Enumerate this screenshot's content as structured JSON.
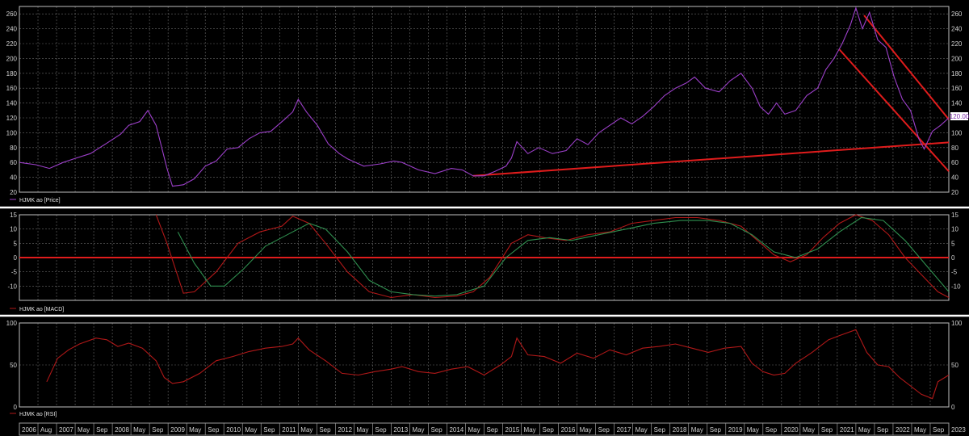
{
  "colors": {
    "background": "#000000",
    "price": "#9b3fc8",
    "macd": "#b01818",
    "signal": "#2f8f4f",
    "rsi": "#b01818",
    "trend": "#e01c1c",
    "separator": "#ffffff",
    "price_badge_bg": "#ffffff",
    "price_badge_fg": "#7a2aa8"
  },
  "current_price_label": "120.00",
  "legend": {
    "price": "HJMK ao [Price]",
    "macd": "HJMK ao [MACD]",
    "rsi": "HJMK ao [RSI]"
  },
  "x_axis_labels": [
    "2006",
    "Aug",
    "2007",
    "May",
    "Sep",
    "2008",
    "May",
    "Sep",
    "2009",
    "May",
    "Sep",
    "2010",
    "May",
    "Sep",
    "2011",
    "May",
    "Sep",
    "2012",
    "May",
    "Sep",
    "2013",
    "May",
    "Sep",
    "2014",
    "May",
    "Sep",
    "2015",
    "May",
    "Sep",
    "2016",
    "May",
    "Sep",
    "2017",
    "May",
    "Sep",
    "2018",
    "May",
    "Sep",
    "2019",
    "May",
    "Sep",
    "2020",
    "May",
    "Sep",
    "2021",
    "May",
    "Sep",
    "2022",
    "May",
    "Sep",
    "2023"
  ],
  "chart_data": [
    {
      "type": "line",
      "panel": "price",
      "x_range": [
        2006.0,
        2023.0
      ],
      "ylim": [
        20,
        270
      ],
      "y_ticks": [
        20,
        40,
        60,
        80,
        100,
        120,
        140,
        160,
        180,
        200,
        220,
        240,
        260
      ],
      "grid": true,
      "legend": "bottom-left",
      "series": [
        {
          "name": "HJMK ao [Price]",
          "points": [
            [
              2006.0,
              60
            ],
            [
              2006.3,
              57
            ],
            [
              2006.55,
              52
            ],
            [
              2006.8,
              60
            ],
            [
              2007.0,
              65
            ],
            [
              2007.3,
              72
            ],
            [
              2007.6,
              86
            ],
            [
              2007.85,
              98
            ],
            [
              2008.0,
              110
            ],
            [
              2008.2,
              115
            ],
            [
              2008.35,
              130
            ],
            [
              2008.5,
              110
            ],
            [
              2008.7,
              52
            ],
            [
              2008.8,
              28
            ],
            [
              2009.0,
              30
            ],
            [
              2009.2,
              38
            ],
            [
              2009.4,
              55
            ],
            [
              2009.6,
              62
            ],
            [
              2009.8,
              78
            ],
            [
              2010.0,
              80
            ],
            [
              2010.2,
              92
            ],
            [
              2010.4,
              100
            ],
            [
              2010.6,
              102
            ],
            [
              2010.85,
              118
            ],
            [
              2011.0,
              128
            ],
            [
              2011.1,
              145
            ],
            [
              2011.25,
              128
            ],
            [
              2011.45,
              110
            ],
            [
              2011.65,
              85
            ],
            [
              2011.85,
              72
            ],
            [
              2012.0,
              65
            ],
            [
              2012.3,
              55
            ],
            [
              2012.6,
              58
            ],
            [
              2012.85,
              62
            ],
            [
              2013.0,
              60
            ],
            [
              2013.3,
              50
            ],
            [
              2013.6,
              45
            ],
            [
              2013.9,
              52
            ],
            [
              2014.1,
              50
            ],
            [
              2014.3,
              42
            ],
            [
              2014.5,
              42
            ],
            [
              2014.7,
              48
            ],
            [
              2014.9,
              55
            ],
            [
              2015.0,
              66
            ],
            [
              2015.1,
              88
            ],
            [
              2015.3,
              72
            ],
            [
              2015.5,
              80
            ],
            [
              2015.75,
              72
            ],
            [
              2016.0,
              76
            ],
            [
              2016.2,
              92
            ],
            [
              2016.4,
              84
            ],
            [
              2016.6,
              100
            ],
            [
              2016.8,
              110
            ],
            [
              2017.0,
              120
            ],
            [
              2017.2,
              112
            ],
            [
              2017.4,
              122
            ],
            [
              2017.6,
              135
            ],
            [
              2017.8,
              150
            ],
            [
              2018.0,
              160
            ],
            [
              2018.2,
              167
            ],
            [
              2018.35,
              175
            ],
            [
              2018.55,
              160
            ],
            [
              2018.8,
              155
            ],
            [
              2019.0,
              170
            ],
            [
              2019.2,
              180
            ],
            [
              2019.4,
              160
            ],
            [
              2019.55,
              135
            ],
            [
              2019.7,
              125
            ],
            [
              2019.85,
              140
            ],
            [
              2020.0,
              125
            ],
            [
              2020.2,
              130
            ],
            [
              2020.4,
              150
            ],
            [
              2020.6,
              160
            ],
            [
              2020.75,
              185
            ],
            [
              2020.9,
              200
            ],
            [
              2021.05,
              220
            ],
            [
              2021.2,
              245
            ],
            [
              2021.3,
              268
            ],
            [
              2021.42,
              240
            ],
            [
              2021.55,
              262
            ],
            [
              2021.7,
              225
            ],
            [
              2021.85,
              215
            ],
            [
              2022.0,
              175
            ],
            [
              2022.15,
              145
            ],
            [
              2022.3,
              130
            ],
            [
              2022.45,
              92
            ],
            [
              2022.55,
              78
            ],
            [
              2022.7,
              102
            ],
            [
              2022.85,
              110
            ],
            [
              2023.0,
              120
            ]
          ]
        }
      ],
      "trendlines": [
        {
          "from": [
            2014.3,
            42
          ],
          "to": [
            2023.0,
            87
          ]
        },
        {
          "from": [
            2021.0,
            212
          ],
          "to": [
            2023.0,
            48
          ]
        },
        {
          "from": [
            2021.45,
            258
          ],
          "to": [
            2023.0,
            118
          ]
        }
      ]
    },
    {
      "type": "line",
      "panel": "macd",
      "x_range": [
        2006.0,
        2023.0
      ],
      "ylim": [
        -15,
        15
      ],
      "y_ticks": [
        -10,
        -5,
        0,
        5,
        10,
        15
      ],
      "zero_line": 0,
      "grid": true,
      "legend": "bottom-left",
      "series": [
        {
          "name": "HJMK ao [MACD]",
          "role": "macd",
          "points": [
            [
              2008.5,
              15
            ],
            [
              2008.7,
              5
            ],
            [
              2009.0,
              -12.5
            ],
            [
              2009.2,
              -12
            ],
            [
              2009.6,
              -5
            ],
            [
              2010.0,
              5
            ],
            [
              2010.4,
              9
            ],
            [
              2010.8,
              11
            ],
            [
              2011.0,
              14.5
            ],
            [
              2011.3,
              12
            ],
            [
              2011.6,
              5
            ],
            [
              2012.0,
              -5
            ],
            [
              2012.4,
              -12
            ],
            [
              2012.8,
              -14
            ],
            [
              2013.2,
              -13
            ],
            [
              2013.6,
              -14
            ],
            [
              2014.0,
              -13.5
            ],
            [
              2014.3,
              -12
            ],
            [
              2014.6,
              -7
            ],
            [
              2015.0,
              5
            ],
            [
              2015.3,
              8
            ],
            [
              2015.6,
              7
            ],
            [
              2016.0,
              6
            ],
            [
              2016.4,
              8
            ],
            [
              2016.8,
              9
            ],
            [
              2017.2,
              12
            ],
            [
              2017.6,
              13
            ],
            [
              2018.0,
              14
            ],
            [
              2018.4,
              14
            ],
            [
              2018.8,
              13
            ],
            [
              2019.2,
              11
            ],
            [
              2019.5,
              6
            ],
            [
              2019.8,
              1
            ],
            [
              2020.1,
              -1.5
            ],
            [
              2020.4,
              1
            ],
            [
              2020.7,
              7
            ],
            [
              2021.0,
              12
            ],
            [
              2021.3,
              15
            ],
            [
              2021.6,
              13
            ],
            [
              2021.9,
              8
            ],
            [
              2022.2,
              0
            ],
            [
              2022.5,
              -6
            ],
            [
              2022.8,
              -12
            ],
            [
              2023.0,
              -14
            ]
          ]
        },
        {
          "name": "Signal",
          "role": "signal",
          "points": [
            [
              2008.9,
              9
            ],
            [
              2009.2,
              -2
            ],
            [
              2009.5,
              -10
            ],
            [
              2009.75,
              -10
            ],
            [
              2010.1,
              -4
            ],
            [
              2010.5,
              4
            ],
            [
              2010.9,
              8
            ],
            [
              2011.3,
              12
            ],
            [
              2011.6,
              10
            ],
            [
              2012.0,
              2
            ],
            [
              2012.4,
              -8
            ],
            [
              2012.8,
              -12
            ],
            [
              2013.2,
              -13
            ],
            [
              2013.6,
              -13.5
            ],
            [
              2014.0,
              -13
            ],
            [
              2014.5,
              -10
            ],
            [
              2014.9,
              0
            ],
            [
              2015.3,
              6
            ],
            [
              2015.7,
              7
            ],
            [
              2016.1,
              6
            ],
            [
              2016.6,
              8
            ],
            [
              2017.1,
              10
            ],
            [
              2017.6,
              12
            ],
            [
              2018.1,
              13
            ],
            [
              2018.6,
              13
            ],
            [
              2019.0,
              12
            ],
            [
              2019.4,
              8
            ],
            [
              2019.8,
              2
            ],
            [
              2020.2,
              0
            ],
            [
              2020.6,
              3
            ],
            [
              2021.0,
              9
            ],
            [
              2021.4,
              14
            ],
            [
              2021.8,
              13
            ],
            [
              2022.2,
              6
            ],
            [
              2022.6,
              -3
            ],
            [
              2023.0,
              -12
            ]
          ]
        }
      ]
    },
    {
      "type": "line",
      "panel": "rsi",
      "x_range": [
        2006.0,
        2023.0
      ],
      "ylim": [
        0,
        100
      ],
      "y_ticks": [
        0,
        50,
        100
      ],
      "grid": true,
      "legend": "bottom-left",
      "series": [
        {
          "name": "HJMK ao [RSI]",
          "points": [
            [
              2006.5,
              30
            ],
            [
              2006.7,
              58
            ],
            [
              2006.9,
              68
            ],
            [
              2007.1,
              75
            ],
            [
              2007.4,
              82
            ],
            [
              2007.6,
              80
            ],
            [
              2007.8,
              72
            ],
            [
              2008.0,
              76
            ],
            [
              2008.25,
              70
            ],
            [
              2008.5,
              55
            ],
            [
              2008.65,
              35
            ],
            [
              2008.8,
              28
            ],
            [
              2009.0,
              30
            ],
            [
              2009.3,
              40
            ],
            [
              2009.6,
              55
            ],
            [
              2009.9,
              60
            ],
            [
              2010.2,
              66
            ],
            [
              2010.5,
              70
            ],
            [
              2010.8,
              72
            ],
            [
              2011.0,
              75
            ],
            [
              2011.1,
              82
            ],
            [
              2011.3,
              68
            ],
            [
              2011.6,
              55
            ],
            [
              2011.9,
              40
            ],
            [
              2012.2,
              38
            ],
            [
              2012.5,
              42
            ],
            [
              2012.8,
              45
            ],
            [
              2013.0,
              48
            ],
            [
              2013.3,
              42
            ],
            [
              2013.6,
              40
            ],
            [
              2013.9,
              45
            ],
            [
              2014.2,
              48
            ],
            [
              2014.5,
              38
            ],
            [
              2014.8,
              50
            ],
            [
              2015.0,
              60
            ],
            [
              2015.1,
              82
            ],
            [
              2015.3,
              62
            ],
            [
              2015.6,
              60
            ],
            [
              2015.9,
              52
            ],
            [
              2016.2,
              64
            ],
            [
              2016.5,
              58
            ],
            [
              2016.8,
              68
            ],
            [
              2017.1,
              62
            ],
            [
              2017.4,
              70
            ],
            [
              2017.7,
              72
            ],
            [
              2018.0,
              75
            ],
            [
              2018.3,
              70
            ],
            [
              2018.6,
              65
            ],
            [
              2018.9,
              70
            ],
            [
              2019.2,
              72
            ],
            [
              2019.4,
              52
            ],
            [
              2019.6,
              42
            ],
            [
              2019.8,
              38
            ],
            [
              2020.0,
              40
            ],
            [
              2020.2,
              52
            ],
            [
              2020.5,
              65
            ],
            [
              2020.8,
              80
            ],
            [
              2021.0,
              85
            ],
            [
              2021.3,
              92
            ],
            [
              2021.5,
              65
            ],
            [
              2021.7,
              50
            ],
            [
              2021.9,
              48
            ],
            [
              2022.1,
              35
            ],
            [
              2022.3,
              25
            ],
            [
              2022.5,
              15
            ],
            [
              2022.7,
              10
            ],
            [
              2022.8,
              30
            ],
            [
              2023.0,
              38
            ]
          ]
        }
      ]
    }
  ]
}
